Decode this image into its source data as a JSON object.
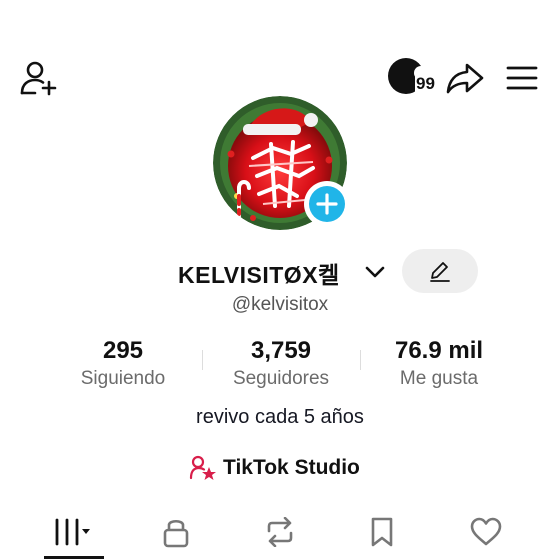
{
  "header": {
    "notification_count": "99"
  },
  "profile": {
    "username": "KELVISITØX켈",
    "handle": "@kelvisitox",
    "bio": "revivo cada 5 años"
  },
  "stats": [
    {
      "value": "295",
      "label": "Siguiendo"
    },
    {
      "value": "3,759",
      "label": "Seguidores"
    },
    {
      "value": "76.9 mil",
      "label": "Me gusta"
    }
  ],
  "studio": {
    "label": "TikTok Studio"
  },
  "colors": {
    "accent_blue": "#20b5e8",
    "studio_icon": "#d81e4a",
    "text": "#161823"
  },
  "tabs": [
    {
      "icon": "grid-icon",
      "active": true
    },
    {
      "icon": "lock-icon",
      "active": false
    },
    {
      "icon": "repost-icon",
      "active": false
    },
    {
      "icon": "bookmark-icon",
      "active": false
    },
    {
      "icon": "heart-icon",
      "active": false
    }
  ]
}
